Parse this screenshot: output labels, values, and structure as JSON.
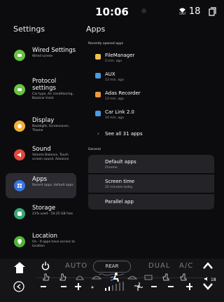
{
  "status_bar": {
    "time": "10:06",
    "wifi_label": "5WiF",
    "temperature": "18"
  },
  "settings": {
    "title": "Settings",
    "scroll_ghost": "—",
    "items": [
      {
        "id": "wired",
        "title": "Wired Settings",
        "subtitle": "Wired screen",
        "color": "#67c440",
        "icon": "wired-settings-icon"
      },
      {
        "id": "protocol",
        "title": "Protocol settings",
        "subtitle": "Car type, Air conditioning, Backcar track",
        "color": "#67c440",
        "icon": "protocol-settings-icon"
      },
      {
        "id": "display",
        "title": "Display",
        "subtitle": "Backlight, Screensaver, Theme",
        "color": "#f0b135",
        "icon": "display-icon"
      },
      {
        "id": "sound",
        "title": "Sound",
        "subtitle": "Volume Balance, Touch screen sound, Advance",
        "color": "#e1473c",
        "icon": "sound-icon"
      },
      {
        "id": "apps",
        "title": "Apps",
        "subtitle": "Recent apps, default apps",
        "color": "#3d74e2",
        "icon": "apps-grid-icon",
        "active": true
      },
      {
        "id": "storage",
        "title": "Storage",
        "subtitle": "21% used - 50.25 GB free",
        "color": "#3aa676",
        "icon": "storage-icon"
      },
      {
        "id": "location",
        "title": "Location",
        "subtitle": "On - 9 apps have access to location",
        "color": "#52b43a",
        "icon": "location-pin-icon"
      }
    ]
  },
  "apps": {
    "title": "Apps",
    "recent_label": "Recently opened apps",
    "recent": [
      {
        "name": "FileManager",
        "time": "2 min. ago",
        "color": "#f2c14e",
        "icon": "file-manager-icon"
      },
      {
        "name": "AUX",
        "time": "13 min. ago",
        "color": "#4a9be0",
        "icon": "aux-icon"
      },
      {
        "name": "Adas Recorder",
        "time": "13 min. ago",
        "color": "#ee9a3a",
        "icon": "adas-recorder-icon"
      },
      {
        "name": "Car Link 2.0",
        "time": "14 min. ago",
        "color": "#4a9be0",
        "icon": "car-link-icon"
      }
    ],
    "see_all": "See all 31 apps",
    "general_label": "General",
    "general": [
      {
        "title": "Default apps",
        "subtitle": "Chrome"
      },
      {
        "title": "Screen time",
        "subtitle": "22 minutes today"
      },
      {
        "title": "Parallel app",
        "subtitle": ""
      }
    ]
  },
  "climate": {
    "auto_label": "AUTO",
    "rear_label": "REAR",
    "dual_label": "DUAL",
    "ac_label": "A/C",
    "volume": "18",
    "fan_level": 0.25
  }
}
